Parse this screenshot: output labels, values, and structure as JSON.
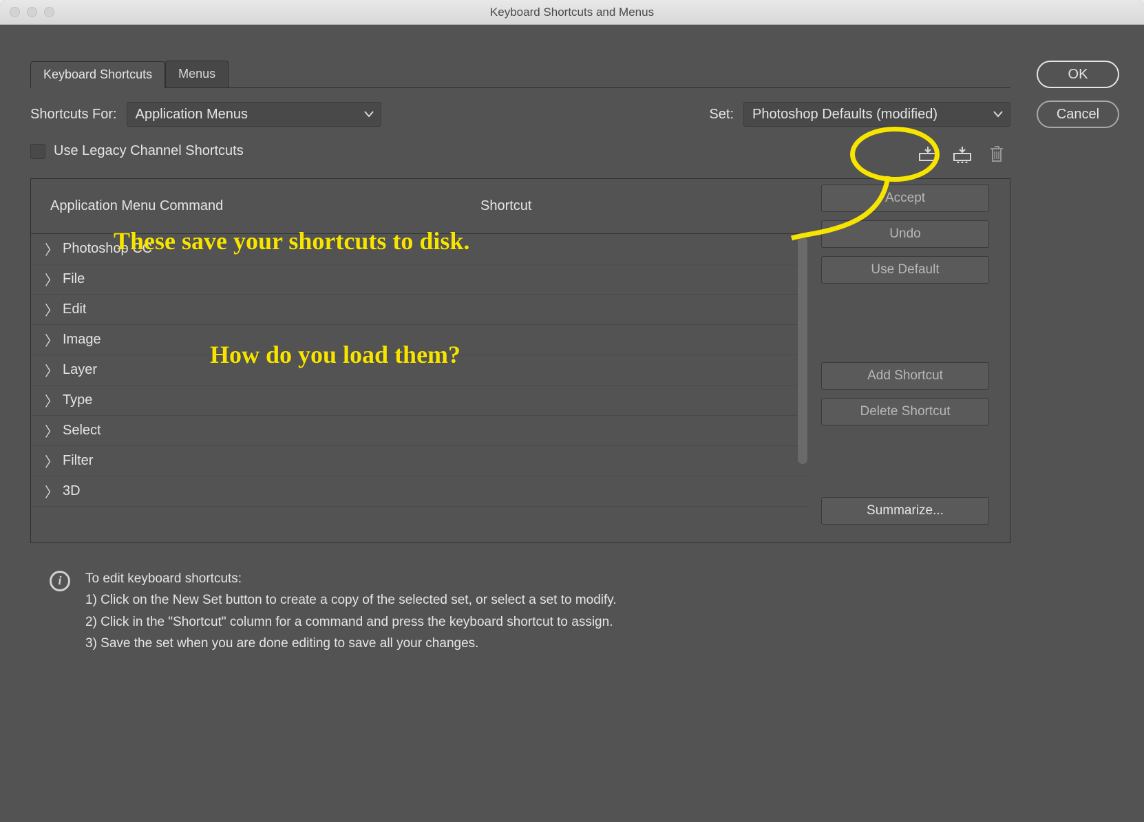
{
  "window": {
    "title": "Keyboard Shortcuts and Menus"
  },
  "tabs": {
    "active": "Keyboard Shortcuts",
    "inactive": "Menus"
  },
  "shortcutsFor": {
    "label": "Shortcuts For:",
    "value": "Application Menus"
  },
  "set": {
    "label": "Set:",
    "value": "Photoshop Defaults (modified)"
  },
  "legacy": {
    "label": "Use Legacy Channel Shortcuts"
  },
  "columns": {
    "cmd": "Application Menu Command",
    "shortcut": "Shortcut"
  },
  "items": [
    "Photoshop CC",
    "File",
    "Edit",
    "Image",
    "Layer",
    "Type",
    "Select",
    "Filter",
    "3D"
  ],
  "buttons": {
    "accept": "Accept",
    "undo": "Undo",
    "useDefault": "Use Default",
    "addShortcut": "Add Shortcut",
    "deleteShortcut": "Delete Shortcut",
    "summarize": "Summarize..."
  },
  "info": {
    "heading": "To edit keyboard shortcuts:",
    "l1": "1) Click on the New Set button to create a copy of the selected set, or select a set to modify.",
    "l2": "2) Click in the \"Shortcut\" column for a command and press the keyboard shortcut to assign.",
    "l3": "3) Save the set when you are done editing to save all your changes."
  },
  "okcancel": {
    "ok": "OK",
    "cancel": "Cancel"
  },
  "annotations": {
    "a1": "These save your shortcuts to disk.",
    "a2": "How do you load them?"
  }
}
